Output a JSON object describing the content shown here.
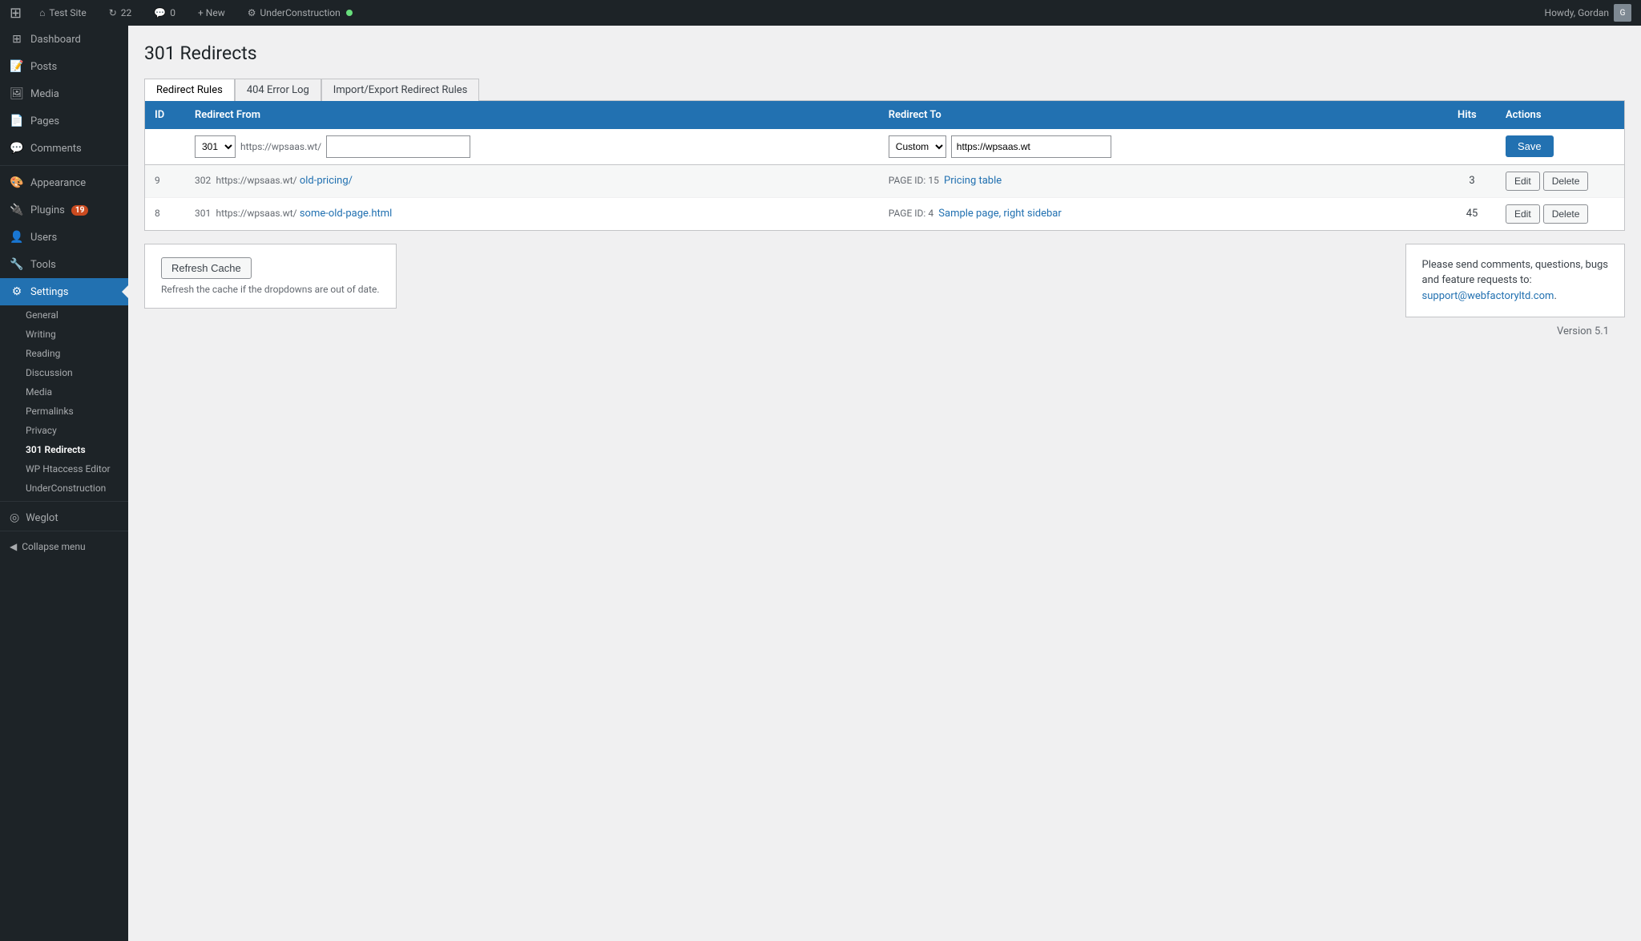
{
  "adminbar": {
    "logo": "⊞",
    "site_name": "Test Site",
    "updates_count": "22",
    "comments_count": "0",
    "new_label": "+ New",
    "plugin_label": "UnderConstruction",
    "howdy": "Howdy, Gordan"
  },
  "sidebar": {
    "items": [
      {
        "id": "dashboard",
        "label": "Dashboard",
        "icon": "⊞"
      },
      {
        "id": "posts",
        "label": "Posts",
        "icon": "📝"
      },
      {
        "id": "media",
        "label": "Media",
        "icon": "🖼"
      },
      {
        "id": "pages",
        "label": "Pages",
        "icon": "📄"
      },
      {
        "id": "comments",
        "label": "Comments",
        "icon": "💬"
      },
      {
        "id": "appearance",
        "label": "Appearance",
        "icon": "🎨"
      },
      {
        "id": "plugins",
        "label": "Plugins",
        "icon": "🔌",
        "badge": "19"
      },
      {
        "id": "users",
        "label": "Users",
        "icon": "👤"
      },
      {
        "id": "tools",
        "label": "Tools",
        "icon": "🔧"
      },
      {
        "id": "settings",
        "label": "Settings",
        "icon": "⚙",
        "active": true
      }
    ],
    "submenu": [
      {
        "id": "general",
        "label": "General"
      },
      {
        "id": "writing",
        "label": "Writing"
      },
      {
        "id": "reading",
        "label": "Reading"
      },
      {
        "id": "discussion",
        "label": "Discussion"
      },
      {
        "id": "media",
        "label": "Media"
      },
      {
        "id": "permalinks",
        "label": "Permalinks"
      },
      {
        "id": "privacy",
        "label": "Privacy"
      },
      {
        "id": "redirects",
        "label": "301 Redirects",
        "active": true
      },
      {
        "id": "htaccess",
        "label": "WP Htaccess Editor"
      },
      {
        "id": "underconstruction",
        "label": "UnderConstruction"
      }
    ],
    "weglot_label": "Weglot",
    "collapse_label": "Collapse menu"
  },
  "page": {
    "title": "301 Redirects",
    "tabs": [
      {
        "id": "redirect-rules",
        "label": "Redirect Rules",
        "active": true
      },
      {
        "id": "404-error-log",
        "label": "404 Error Log"
      },
      {
        "id": "import-export",
        "label": "Import/Export Redirect Rules"
      }
    ],
    "table": {
      "columns": [
        "ID",
        "Redirect From",
        "Redirect To",
        "Hits",
        "Actions"
      ],
      "new_row": {
        "select_301_value": "301",
        "base_url": "https://wpsaas.wt/",
        "path_placeholder": "",
        "redirect_to_select": "Custom",
        "redirect_to_input": "https://wpsaas.wt",
        "save_label": "Save"
      },
      "rows": [
        {
          "id": "9",
          "redirect_from_code": "302",
          "redirect_from_base": "https://wpsaas.wt/",
          "redirect_from_path": "old-pricing/",
          "redirect_to_type": "PAGE",
          "redirect_to_id": "ID: 15",
          "redirect_to_label": "Pricing table",
          "hits": "3",
          "edit_label": "Edit",
          "delete_label": "Delete"
        },
        {
          "id": "8",
          "redirect_from_code": "301",
          "redirect_from_base": "https://wpsaas.wt/",
          "redirect_from_path": "some-old-page.html",
          "redirect_to_type": "PAGE",
          "redirect_to_id": "ID: 4",
          "redirect_to_label": "Sample page, right sidebar",
          "hits": "45",
          "edit_label": "Edit",
          "delete_label": "Delete"
        }
      ]
    },
    "refresh_cache": {
      "button_label": "Refresh Cache",
      "description": "Refresh the cache if the dropdowns are out of date."
    },
    "info_box": {
      "text_before": "Please send comments, questions, bugs\nand feature requests to:",
      "email": "support@webfactoryltd.com",
      "text_after": "."
    },
    "version": "Version 5.1"
  }
}
